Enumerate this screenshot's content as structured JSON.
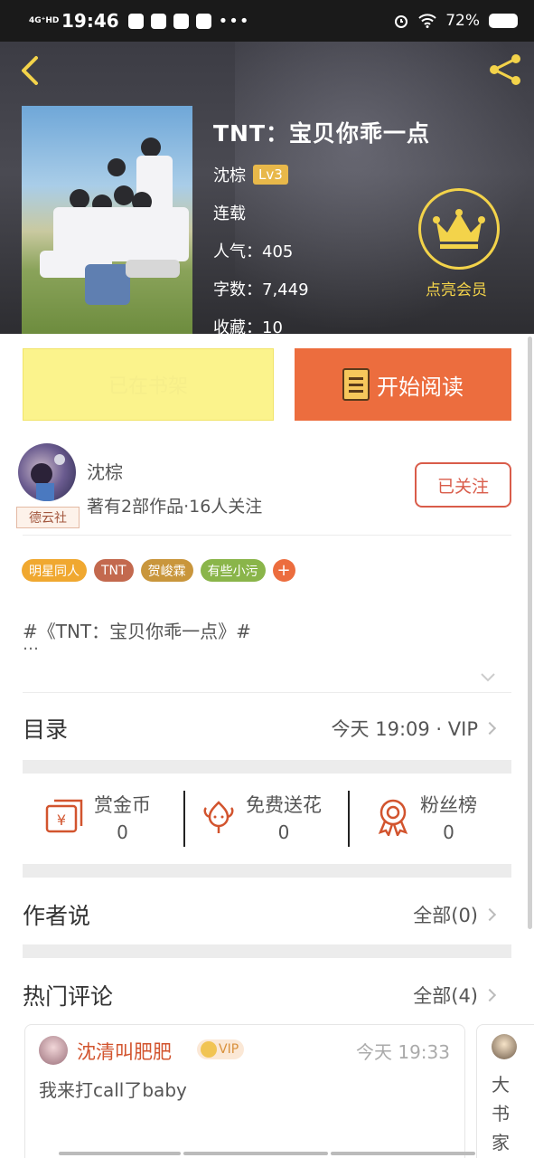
{
  "status_bar": {
    "network": "4G⁺HD",
    "time": "19:46",
    "battery": "72%"
  },
  "book": {
    "title": "TNT：宝贝你乖一点",
    "author": "沈棕",
    "level": "Lv3",
    "status": "连载",
    "popularity_label": "人气：",
    "popularity": "405",
    "words_label": "字数：",
    "words": "7,449",
    "favorites_label": "收藏：",
    "favorites": "10"
  },
  "member": {
    "label": "点亮会员"
  },
  "actions": {
    "shelf": "已在书架",
    "read": "开始阅读"
  },
  "author_card": {
    "name": "沈棕",
    "stats": "著有2部作品·16人关注",
    "badge": "德云社",
    "follow": "已关注"
  },
  "tags": [
    {
      "label": "明星同人",
      "color": "#f0a830"
    },
    {
      "label": "TNT",
      "color": "#c3694e"
    },
    {
      "label": "贺峻霖",
      "color": "#c9963c"
    },
    {
      "label": "有些小污",
      "color": "#8ab54a"
    }
  ],
  "description": {
    "line1": "#《TNT：宝贝你乖一点》#",
    "line2": "…"
  },
  "toc": {
    "title": "目录",
    "update": "今天 19:09 · VIP"
  },
  "stats": [
    {
      "label": "赏金币",
      "value": "0",
      "icon": "coin-envelope-icon"
    },
    {
      "label": "免费送花",
      "value": "0",
      "icon": "flower-icon"
    },
    {
      "label": "粉丝榜",
      "value": "0",
      "icon": "medal-icon"
    }
  ],
  "author_says": {
    "title": "作者说",
    "all": "全部(0)"
  },
  "hot_comments": {
    "title": "热门评论",
    "all": "全部(4)"
  },
  "comments": [
    {
      "user": "沈清叫肥肥",
      "badge": "VIP",
      "time": "今天 19:33",
      "text": "我来打call了baby"
    },
    {
      "text": "大书家"
    }
  ],
  "colors": {
    "accent": "#ec6d3e",
    "shelf": "#fbf38c",
    "gold": "#f3d34a",
    "follow": "#d95c4a"
  }
}
